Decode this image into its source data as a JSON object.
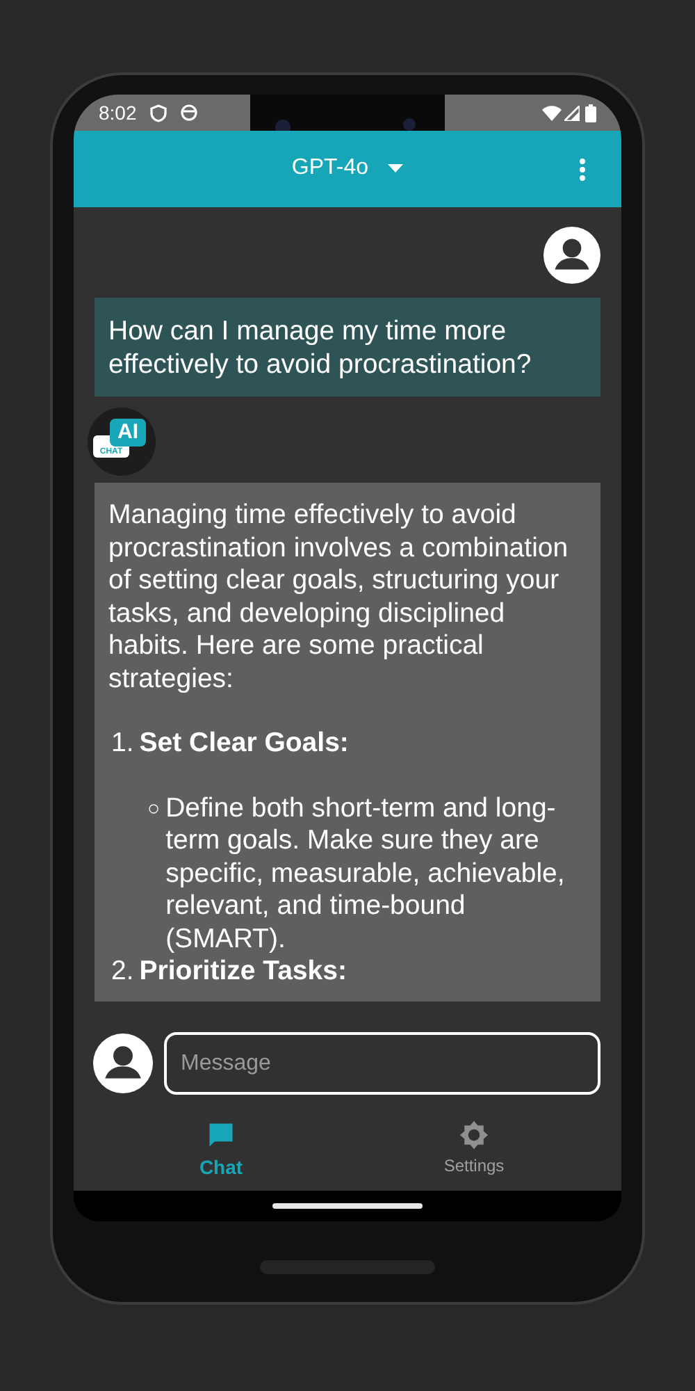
{
  "status_bar": {
    "time": "8:02"
  },
  "app_bar": {
    "title": "GPT-4o"
  },
  "messages": [
    {
      "kind": "user",
      "text": "How can I manage my time more effectively to avoid procrastination?"
    },
    {
      "kind": "assistant",
      "avatar": {
        "badge": "AI",
        "caption": "CHAT"
      },
      "intro": "Managing time effectively to avoid procrastination involves a combination of setting clear goals, structuring your tasks, and developing disciplined habits. Here are some practical strategies:",
      "items": [
        {
          "number": "1.",
          "title": "Set Clear Goals:",
          "bullets": [
            {
              "marker": "○",
              "text": "Define both short-term and long-term goals. Make sure they are specific, measurable, achievable, relevant, and time-bound (SMART)."
            }
          ]
        },
        {
          "number": "2.",
          "title": "Prioritize Tasks:"
        }
      ]
    }
  ],
  "composer": {
    "placeholder": "Message"
  },
  "bottom_nav": [
    {
      "kind": "chat",
      "label": "Chat",
      "selected": true
    },
    {
      "kind": "settings",
      "label": "Settings",
      "selected": false
    }
  ]
}
